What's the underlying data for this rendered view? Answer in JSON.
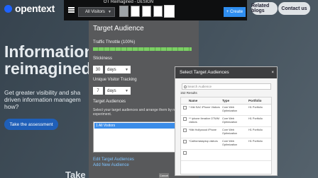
{
  "website": {
    "logo_text": "opentext",
    "related_blogs": "Related blogs",
    "contact_us": "Contact us",
    "headline_line1": "Information",
    "headline_line2": "reimagined",
    "subline": "Get greater visibility and sha driven information managem how?",
    "assessment_button": "Take the assessment",
    "bottom_text": "Take"
  },
  "toolbar": {
    "title": "OT Reimagined - DESIGN",
    "visitors_select": "All Visitors",
    "create_button": "+ Create"
  },
  "target_audience": {
    "title": "Target Audience",
    "traffic_throttle_label": "Traffic Throttle (100%)",
    "traffic_throttle_percent": 100,
    "stickiness_label": "Stickiness",
    "stickiness_value": "30",
    "stickiness_unit": "days",
    "unique_tracking_label": "Unique Visitor Tracking",
    "unique_tracking_value": "7",
    "unique_tracking_unit": "days",
    "audiences_label": "Target Audiences",
    "audiences_desc": "Select your target audiences and arrange them by relevan this experiment.",
    "selected_audience": "1 All Visitors",
    "edit_link": "Edit Target Audiences",
    "add_link": "Add New Audience",
    "cancel_button": "Cancel"
  },
  "modal": {
    "title": "Select Target Audiences",
    "close": "×",
    "search_placeholder": "Search Audience",
    "results": "152 Results",
    "columns": {
      "name": "Name",
      "type": "Type",
      "portfolio": "Portfolio"
    },
    "rows": [
      {
        "name": "* Mkt SAC iPhone Visitors",
        "type": "Core Web Optimization",
        "portfolio": "H1 Portfolio"
      },
      {
        "name": "** iphone Iterative OTWM visitors",
        "type": "Core Web Optimization",
        "portfolio": "H1 Portfolio"
      },
      {
        "name": "*Mkt Hollywood iPhone",
        "type": "Core Web Optimization",
        "portfolio": "H1 Portfolio"
      },
      {
        "name": "*Californialaptop visitors",
        "type": "Core Web Optimization",
        "portfolio": "H1 Portfolio"
      },
      {
        "name": "",
        "type": "",
        "portfolio": ""
      }
    ]
  },
  "colors": {
    "accent_blue": "#2f8ef0",
    "throttle_green": "#7bcf64",
    "panel_gray": "#58595b"
  }
}
